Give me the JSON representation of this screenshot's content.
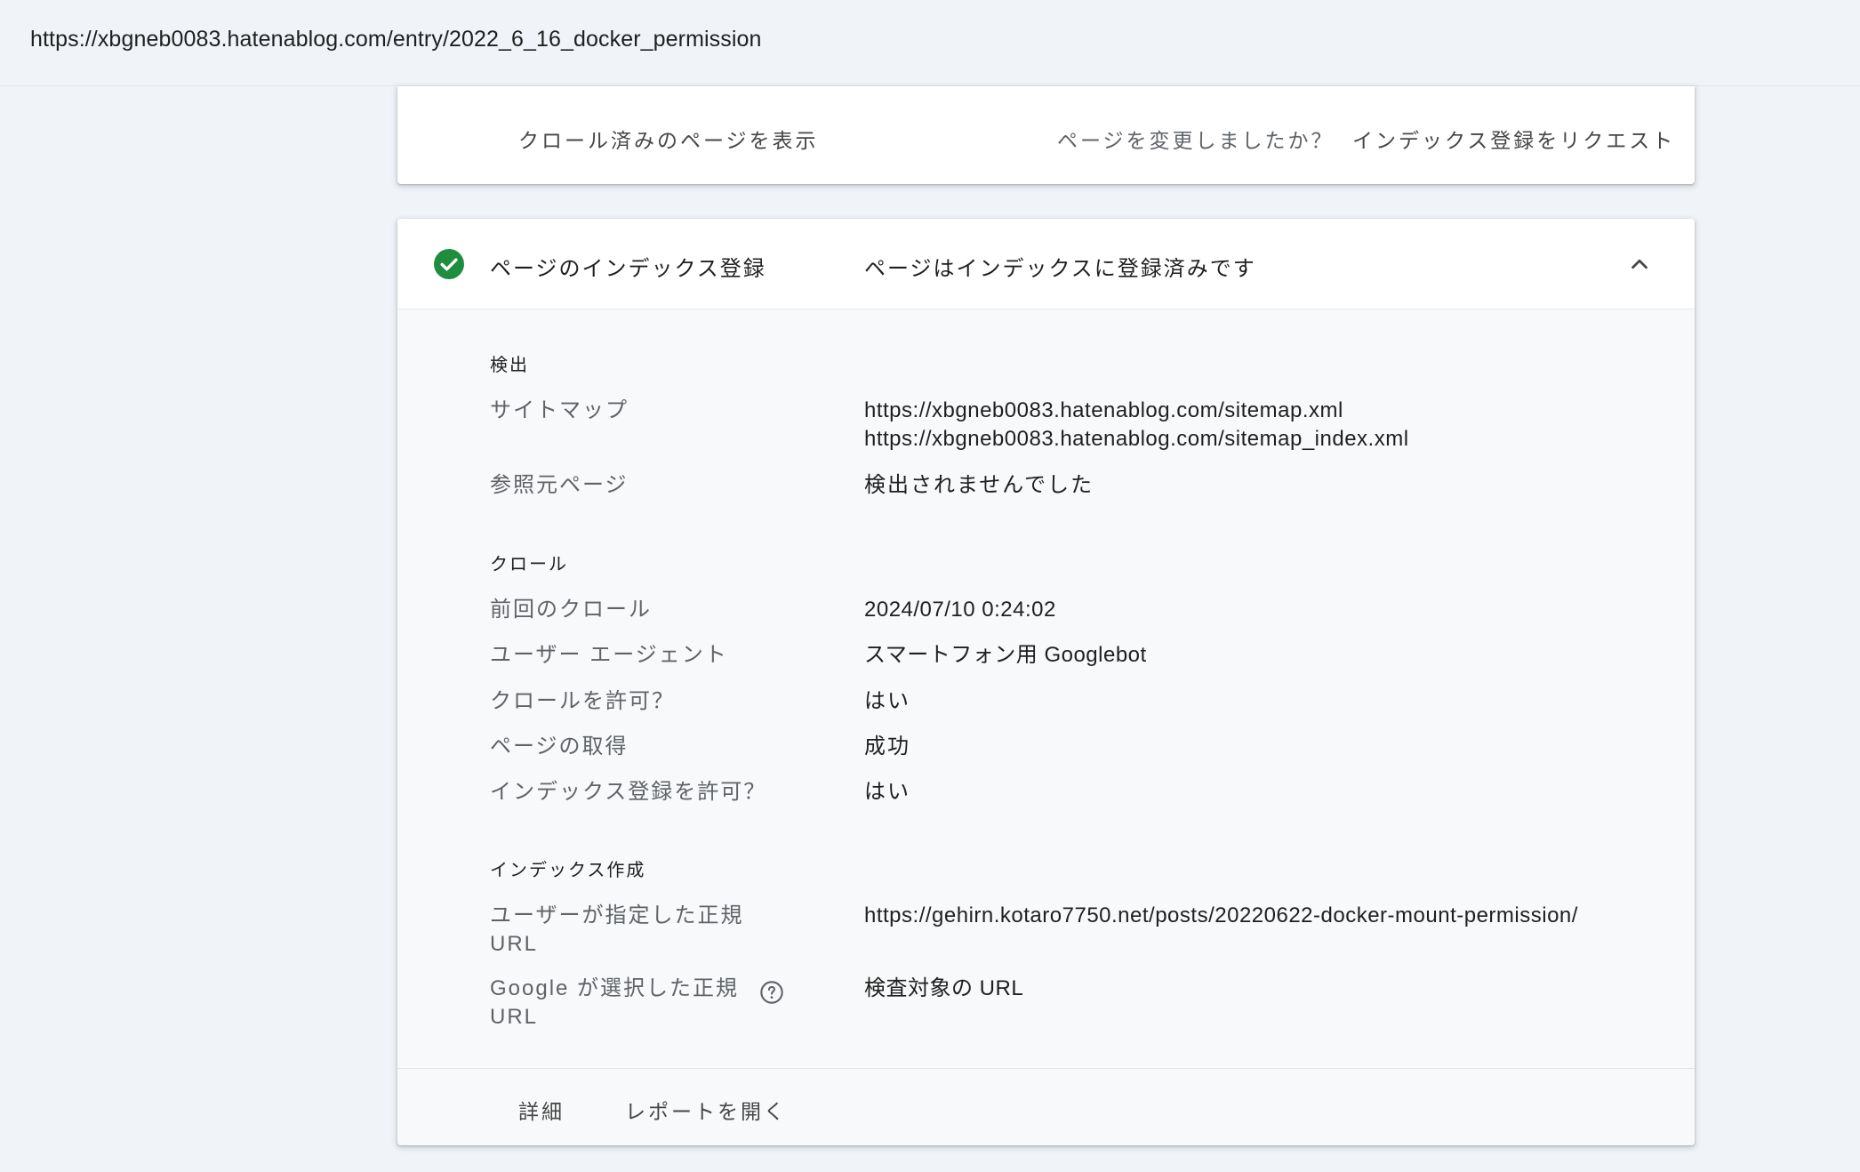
{
  "address_bar": {
    "url": "https://xbgneb0083.hatenablog.com/entry/2022_6_16_docker_permission"
  },
  "top_card": {
    "view_crawled_page": "クロール済みのページを表示",
    "changed_question": "ページを変更しましたか？",
    "request_indexing": "インデックス登録をリクエスト"
  },
  "indexing_card": {
    "title": "ページのインデックス登録",
    "status": "ページはインデックスに登録済みです",
    "status_color": "#1e8e3e",
    "icons": {
      "status": "check-circle-icon",
      "collapse": "chevron-up-icon",
      "help": "help-circle-icon"
    },
    "discovery": {
      "heading": "検出",
      "sitemap_label": "サイトマップ",
      "sitemaps": [
        "https://xbgneb0083.hatenablog.com/sitemap.xml",
        "https://xbgneb0083.hatenablog.com/sitemap_index.xml"
      ],
      "referring_label": "参照元ページ",
      "referring_value": "検出されませんでした"
    },
    "crawl": {
      "heading": "クロール",
      "rows": [
        {
          "label": "前回のクロール",
          "value": "2024/07/10 0:24:02"
        },
        {
          "label": "ユーザー エージェント",
          "value": "スマートフォン用 Googlebot"
        },
        {
          "label": "クロールを許可？",
          "value": "はい"
        },
        {
          "label": "ページの取得",
          "value": "成功"
        },
        {
          "label": "インデックス登録を許可？",
          "value": "はい"
        }
      ]
    },
    "indexing": {
      "heading": "インデックス作成",
      "user_canonical_label_line1": "ユーザーが指定した正規",
      "user_canonical_label_line2": "URL",
      "user_canonical_value": "https://gehirn.kotaro7750.net/posts/20220622-docker-mount-permission/",
      "google_canonical_label_line1": "Google が選択した正規",
      "google_canonical_label_line2": "URL",
      "google_canonical_value": "検査対象の URL"
    },
    "footer": {
      "details": "詳細",
      "open_report": "レポートを開く"
    }
  }
}
